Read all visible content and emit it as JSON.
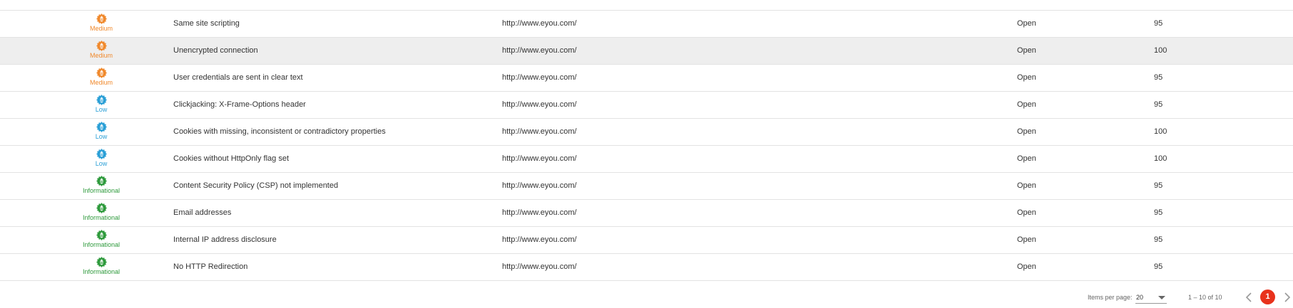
{
  "colors": {
    "medium": "#f0892c",
    "low": "#2a9fd6",
    "informational": "#2e9a3c",
    "accent": "#e8321c"
  },
  "rows": [
    {
      "severity": "Medium",
      "name": "Same site scripting",
      "url": "http://www.eyou.com/",
      "status": "Open",
      "confidence": "95"
    },
    {
      "severity": "Medium",
      "name": "Unencrypted connection",
      "url": "http://www.eyou.com/",
      "status": "Open",
      "confidence": "100"
    },
    {
      "severity": "Medium",
      "name": "User credentials are sent in clear text",
      "url": "http://www.eyou.com/",
      "status": "Open",
      "confidence": "95"
    },
    {
      "severity": "Low",
      "name": "Clickjacking: X-Frame-Options header",
      "url": "http://www.eyou.com/",
      "status": "Open",
      "confidence": "95"
    },
    {
      "severity": "Low",
      "name": "Cookies with missing, inconsistent or contradictory properties",
      "url": "http://www.eyou.com/",
      "status": "Open",
      "confidence": "100"
    },
    {
      "severity": "Low",
      "name": "Cookies without HttpOnly flag set",
      "url": "http://www.eyou.com/",
      "status": "Open",
      "confidence": "100"
    },
    {
      "severity": "Informational",
      "name": "Content Security Policy (CSP) not implemented",
      "url": "http://www.eyou.com/",
      "status": "Open",
      "confidence": "95"
    },
    {
      "severity": "Informational",
      "name": "Email addresses",
      "url": "http://www.eyou.com/",
      "status": "Open",
      "confidence": "95"
    },
    {
      "severity": "Informational",
      "name": "Internal IP address disclosure",
      "url": "http://www.eyou.com/",
      "status": "Open",
      "confidence": "95"
    },
    {
      "severity": "Informational",
      "name": "No HTTP Redirection",
      "url": "http://www.eyou.com/",
      "status": "Open",
      "confidence": "95"
    }
  ],
  "pagination": {
    "items_per_page_label": "Items per page:",
    "items_per_page_value": "20",
    "range_label": "1 – 10 of 10",
    "current_page": "1"
  }
}
